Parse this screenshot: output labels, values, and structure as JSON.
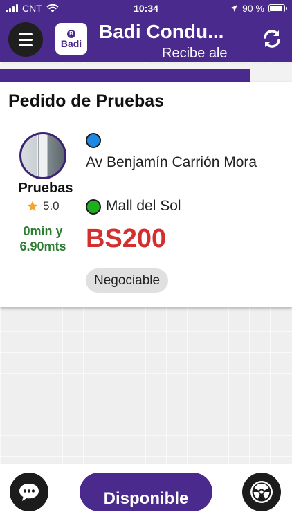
{
  "status_bar": {
    "carrier": "CNT",
    "time": "10:34",
    "battery": "90 %",
    "battery_level": 0.9
  },
  "app_bar": {
    "title": "Badi Condu...",
    "subtitle": "Recibe ale",
    "logo_text": "Badi",
    "logo_badge": "B",
    "menu_icon": "hamburger-menu-icon",
    "refresh_icon": "refresh-icon"
  },
  "progress": {
    "fraction": 0.857
  },
  "order": {
    "title": "Pedido de Pruebas",
    "driver_name": "Pruebas",
    "rating": "5.0",
    "eta": "0min y 6.90mts",
    "origin": "Av Benjamín Carrión Mora",
    "destination": "Mall del Sol",
    "price": "BS200",
    "tag": "Negociable"
  },
  "bottom_bar": {
    "available_label": "Disponible",
    "chat_icon": "chat-bubble-icon",
    "radiation_icon": "radiation-icon"
  },
  "colors": {
    "brand": "#4a2a8c",
    "price": "#d32f2f",
    "eta": "#2e7d32",
    "origin_dot": "#1e88e5",
    "destination_dot": "#1db01d"
  }
}
